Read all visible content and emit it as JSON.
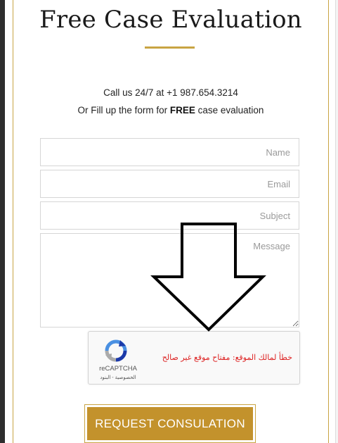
{
  "form": {
    "title": "Free Case Evaluation",
    "call_line": "Call us 24/7 at +1 987.654.3214",
    "fill_prefix": "Or Fill up the form for ",
    "fill_bold": "FREE",
    "fill_suffix": " case evaluation",
    "name_placeholder": "Name",
    "email_placeholder": "Email",
    "subject_placeholder": "Subject",
    "message_placeholder": "Message",
    "submit_label": "REQUEST CONSULATION"
  },
  "recaptcha": {
    "brand": "reCAPTCHA",
    "links": "الخصوصية - البنود",
    "error_text": "خطأ لمالك الموقع: مفتاح موقع غير صالح"
  },
  "colors": {
    "accent_gold": "#c8a443",
    "button_gold": "#c3922c",
    "error_red": "#dd2222"
  }
}
